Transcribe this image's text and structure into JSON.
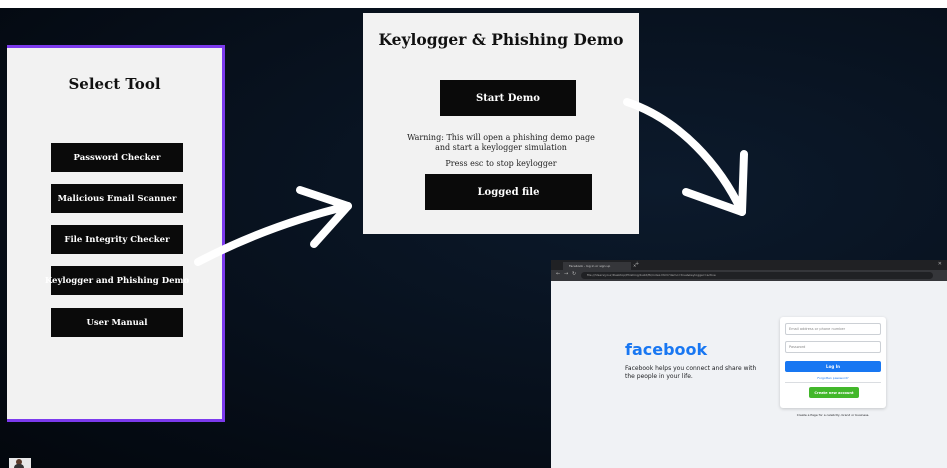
{
  "tool_panel": {
    "title": "Select Tool",
    "buttons": [
      "Password Checker",
      "Malicious Email Scanner",
      "File Integrity Checker",
      "Keylogger and Phishing Demo",
      "User Manual"
    ],
    "border_color": "#7c3aed"
  },
  "demo_panel": {
    "title": "Keylogger & Phishing Demo",
    "start_button": "Start Demo",
    "warning_line1": "Warning: This will open a phishing demo page",
    "warning_line2": "and start a keylogger simulation",
    "stop_hint": "Press esc to stop keylogger",
    "logged_button": "Logged file"
  },
  "browser": {
    "tab_title": "Facebook - log in or sign up",
    "url": "file:///Users/your/Desktop/Phishing/build/fb/index.html?demo=true&keylogger=active",
    "logo": "facebook",
    "tagline": "Facebook helps you connect and share with the people in your life.",
    "email_placeholder": "Email address or phone number",
    "password_placeholder": "Password",
    "login_button": "Log In",
    "forgot_link": "Forgotten password?",
    "create_button": "Create new account",
    "page_note": "Create a Page for a celebrity, brand or business.",
    "brand_color": "#1877f2",
    "create_color": "#42b72a"
  }
}
